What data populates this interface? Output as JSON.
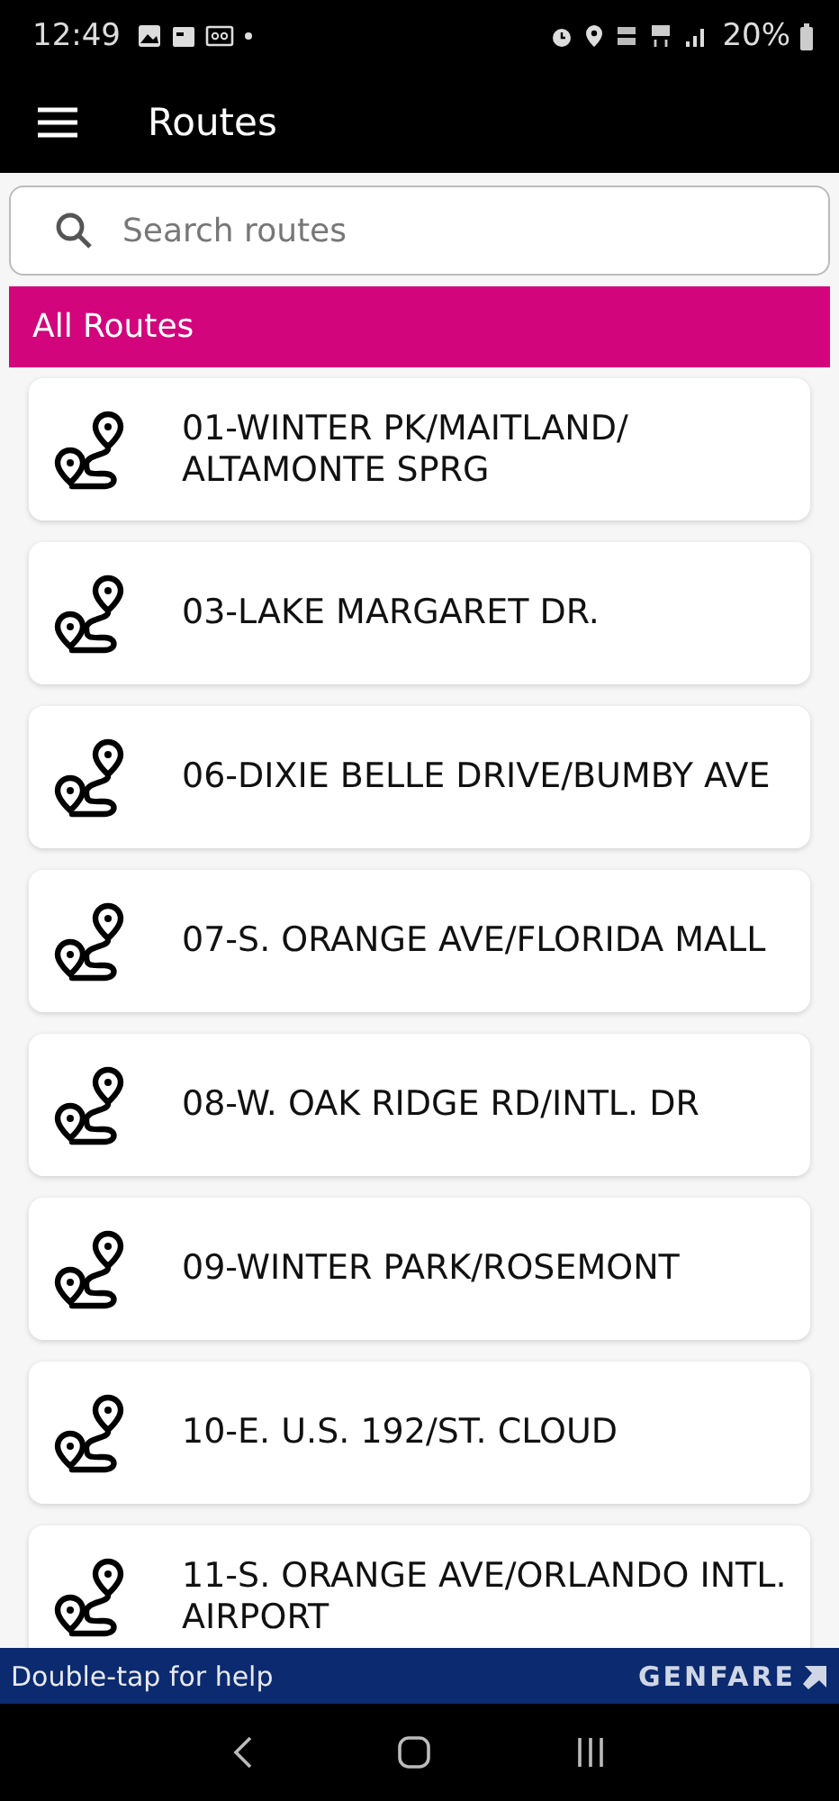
{
  "status_bar": {
    "time": "12:49",
    "battery": "20%"
  },
  "app_bar": {
    "title": "Routes"
  },
  "search": {
    "placeholder": "Search routes"
  },
  "section": {
    "title": "All Routes"
  },
  "routes": [
    {
      "name": "01-WINTER PK/MAITLAND/ ALTAMONTE SPRG"
    },
    {
      "name": "03-LAKE MARGARET DR."
    },
    {
      "name": "06-DIXIE BELLE DRIVE/BUMBY AVE"
    },
    {
      "name": "07-S. ORANGE AVE/FLORIDA MALL"
    },
    {
      "name": "08-W. OAK RIDGE RD/INTL. DR"
    },
    {
      "name": "09-WINTER PARK/ROSEMONT"
    },
    {
      "name": "10-E. U.S. 192/ST. CLOUD"
    },
    {
      "name": "11-S. ORANGE AVE/ORLANDO INTL. AIRPORT"
    }
  ],
  "footer": {
    "hint": "Double-tap for help",
    "brand": "GENFARE"
  }
}
